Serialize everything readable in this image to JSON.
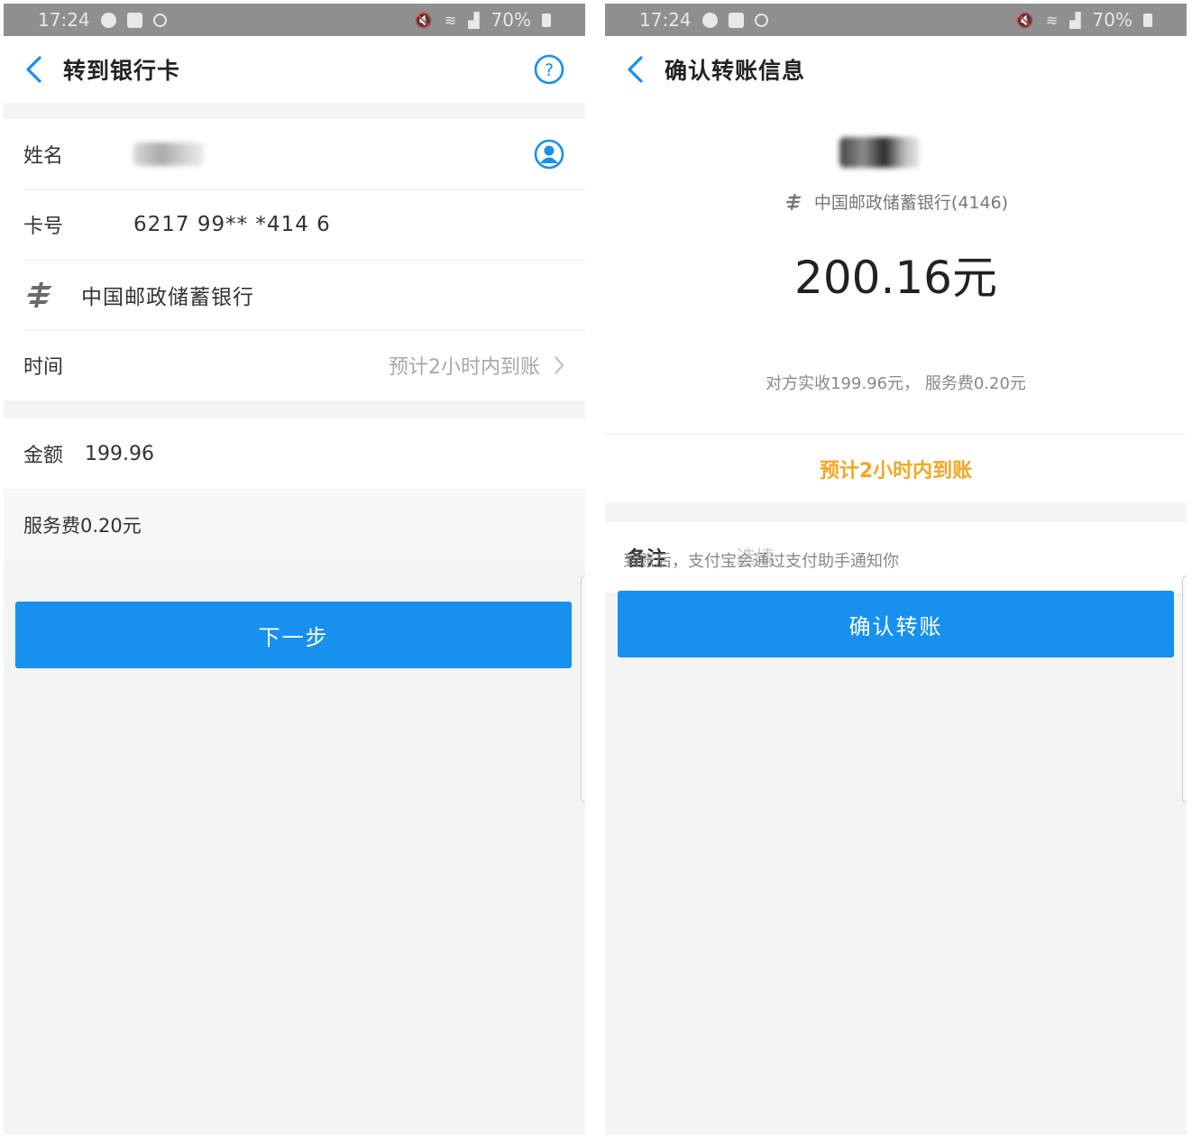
{
  "status_bar": {
    "time": "17:24",
    "battery": "70%"
  },
  "left": {
    "title": "转到银行卡",
    "name_label": "姓名",
    "card_label": "卡号",
    "card_number": "6217 99** *414 6",
    "bank_name": "中国邮政储蓄银行",
    "time_label": "时间",
    "time_value": "预计2小时内到账",
    "amount_label": "金额",
    "amount_value": "199.96",
    "fee_text": "服务费0.20元",
    "next_button": "下一步"
  },
  "right": {
    "title": "确认转账信息",
    "bank_line": "中国邮政储蓄银行(4146)",
    "amount": "200.16元",
    "sub_note": "对方实收199.96元， 服务费0.20元",
    "arrival": "预计2小时内到账",
    "remark_label": "备注",
    "remark_placeholder": "选填",
    "notify": "到账后，支付宝会通过支付助手通知你",
    "confirm_button": "确认转账"
  },
  "colors": {
    "accent": "#1890ee",
    "warning": "#f5a623",
    "status_bar": "#8f8f8f"
  },
  "icons": [
    "back-arrow-icon",
    "help-icon",
    "contact-icon",
    "postal-bank-logo",
    "chevron-right-icon",
    "alarm-icon",
    "mail-icon",
    "search-icon",
    "mute-icon",
    "wifi-icon",
    "signal-icon",
    "battery-icon"
  ]
}
